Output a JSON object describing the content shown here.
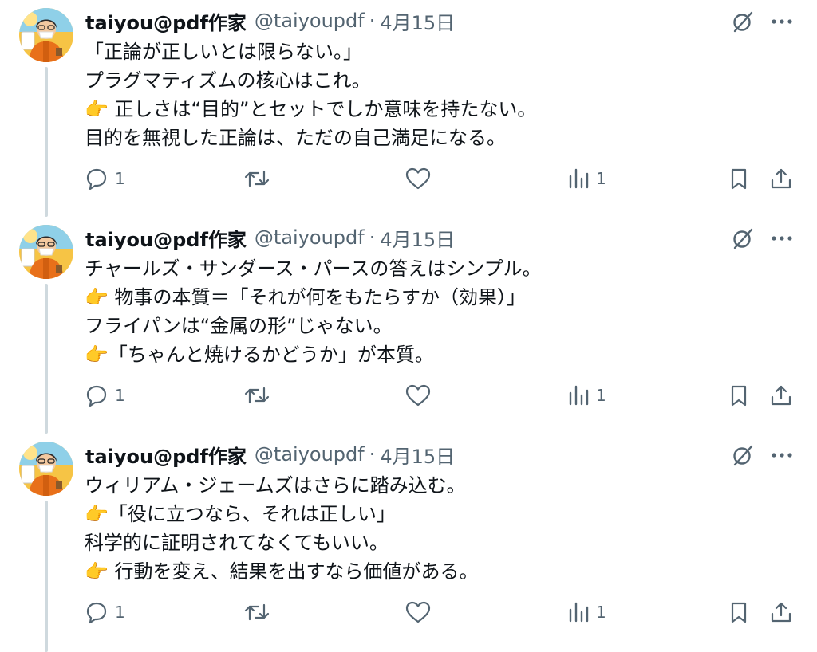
{
  "tweets": [
    {
      "display_name": "taiyou@pdf作家",
      "handle": "@taiyoupdf",
      "separator": "·",
      "date": "4月15日",
      "lines": [
        "「正論が正しいとは限らない。」",
        "プラグマティズムの核心はこれ。",
        "👉 正しさは“目的”とセットでしか意味を持たない。",
        "目的を無視した正論は、ただの自己満足になる。"
      ],
      "reply_count": "1",
      "view_count": "1"
    },
    {
      "display_name": "taiyou@pdf作家",
      "handle": "@taiyoupdf",
      "separator": "·",
      "date": "4月15日",
      "lines": [
        "チャールズ・サンダース・パースの答えはシンプル。",
        "👉 物事の本質＝「それが何をもたらすか（効果）」",
        "フライパンは“金属の形”じゃない。",
        "👉「ちゃんと焼けるかどうか」が本質。"
      ],
      "reply_count": "1",
      "view_count": "1"
    },
    {
      "display_name": "taiyou@pdf作家",
      "handle": "@taiyoupdf",
      "separator": "·",
      "date": "4月15日",
      "lines": [
        "ウィリアム・ジェームズはさらに踏み込む。",
        "👉「役に立つなら、それは正しい」",
        "科学的に証明されてなくてもいい。",
        "👉 行動を変え、結果を出すなら価値がある。"
      ],
      "reply_count": "1",
      "view_count": "1"
    }
  ],
  "icons": {
    "grok": "grok-slash-circle-icon",
    "more": "more-dots-icon",
    "reply": "reply-bubble-icon",
    "repost": "repost-arrows-icon",
    "like": "heart-icon",
    "views": "views-bar-chart-icon",
    "bookmark": "bookmark-icon",
    "share": "share-upload-icon"
  },
  "colors": {
    "text": "#0f1419",
    "secondary": "#536471",
    "thread_line": "#cfd9de",
    "avatar_shirt": "#e8701a"
  }
}
